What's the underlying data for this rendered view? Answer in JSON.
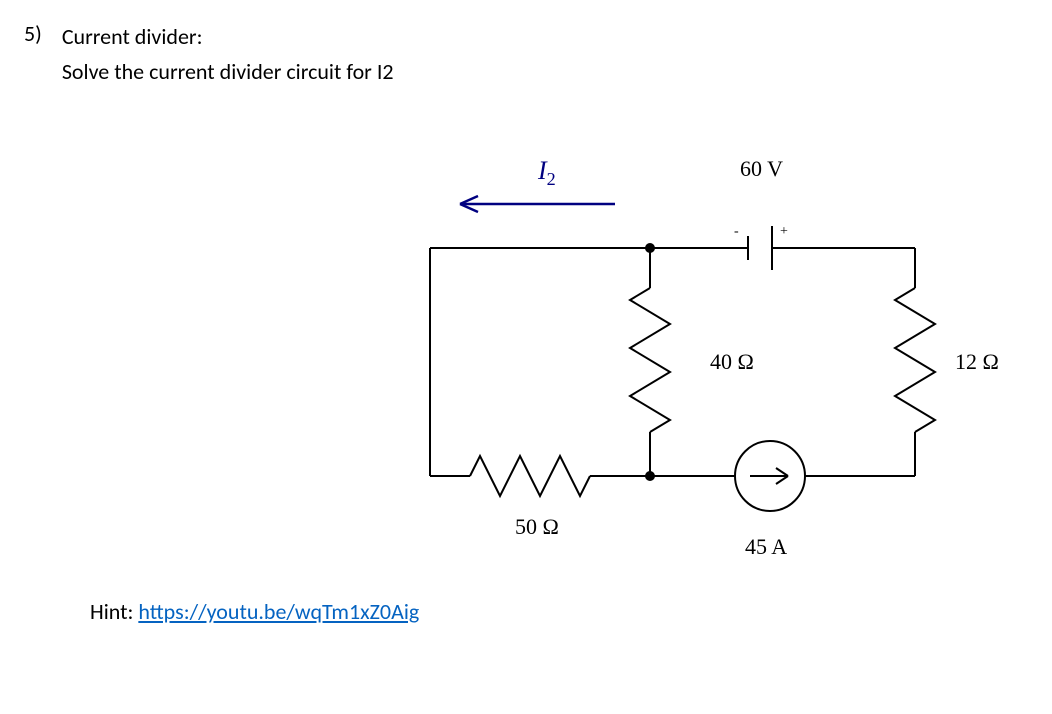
{
  "problem": {
    "number": "5)",
    "title": "Current divider:",
    "instruction": "Solve the current divider circuit for I2"
  },
  "circuit": {
    "i2_label": "I",
    "i2_sub": "2",
    "voltage": "60 V",
    "r_40": "40 Ω",
    "r_12": "12 Ω",
    "r_50": "50 Ω",
    "current_src": "45 A"
  },
  "hint": {
    "prefix": "Hint: ",
    "link_text": "https://youtu.be/wqTm1xZ0Aig",
    "href": "https://youtu.be/wqTm1xZ0Aig"
  }
}
